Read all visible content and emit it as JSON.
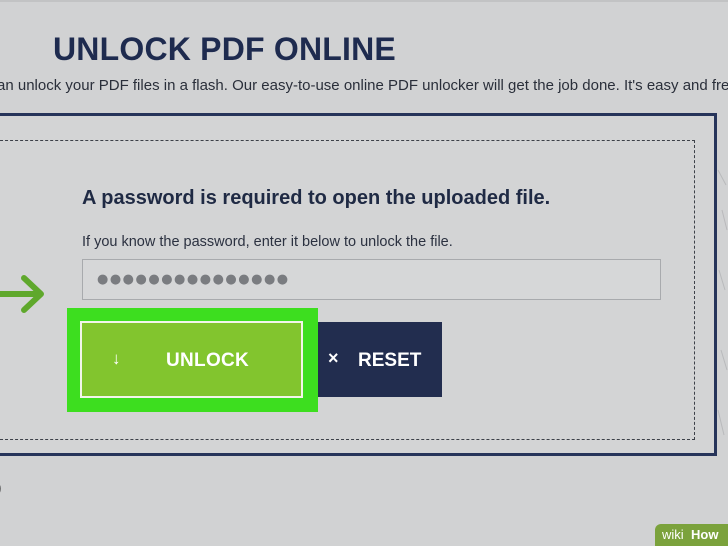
{
  "page": {
    "title": "UNLOCK PDF ONLINE",
    "subtitle": "an unlock your PDF files in a flash. Our easy-to-use online PDF unlocker will get the job done. It's easy and free*",
    "bottom_fragment": ")"
  },
  "password_prompt": {
    "heading": "A password is required to open the uploaded file.",
    "help_text": "If you know the password, enter it below to unlock the file.",
    "input_value": "●●●●●●●●●●●●●●●"
  },
  "actions": {
    "unlock": {
      "icon": "↓",
      "label": "UNLOCK",
      "icon_name": "down-arrow-icon"
    },
    "reset": {
      "icon": "×",
      "label": "RESET",
      "icon_name": "close-icon"
    }
  },
  "annotation": {
    "arrow_icon": "right-arrow-icon",
    "arrow_color": "#5fa82c",
    "highlight_color": "#3dde1f"
  },
  "colors": {
    "title": "#1e2b4f",
    "panel_border": "#26345a",
    "unlock_bg": "#82c52e",
    "reset_bg": "#222d4f",
    "page_bg": "#d1d2d3"
  },
  "watermark": {
    "wiki": "wiki",
    "how": "How"
  }
}
